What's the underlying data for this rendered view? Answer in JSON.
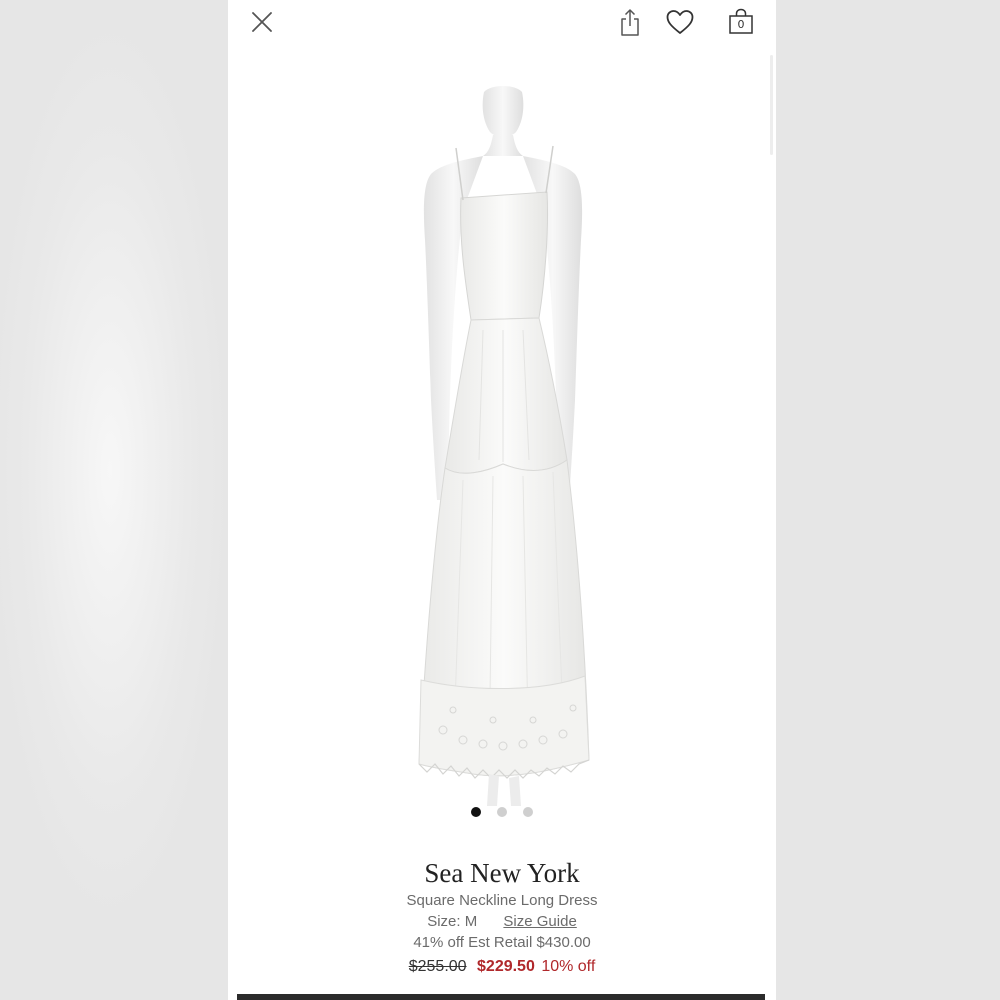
{
  "topbar": {
    "close_icon": "close-icon",
    "share_icon": "share-icon",
    "wishlist_icon": "heart-icon",
    "bag_icon": "shopping-bag-icon",
    "bag_count": "0"
  },
  "gallery": {
    "image_description": "white dress on mannequin",
    "total_images": 3,
    "active_index": 0
  },
  "product": {
    "brand": "Sea New York",
    "name": "Square Neckline Long Dress",
    "size_text": "Size: M",
    "size_guide_label": "Size Guide",
    "retail_text": "41% off Est Retail $430.00",
    "original_price": "$255.00",
    "sale_price": "$229.50",
    "discount_text": "10% off"
  },
  "colors": {
    "sale": "#b0282b",
    "text": "#222222",
    "muted": "#6b6b6b"
  }
}
